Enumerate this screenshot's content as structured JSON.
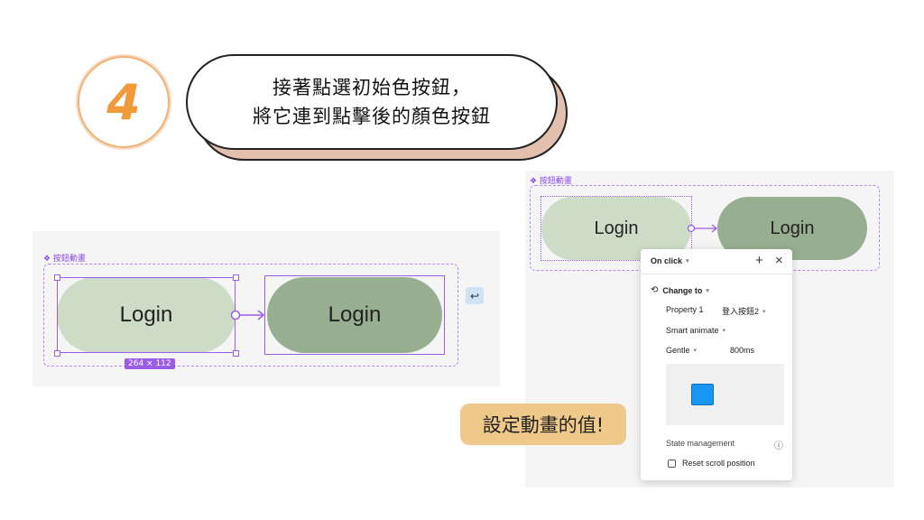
{
  "step": {
    "number": "4"
  },
  "instruction": {
    "line1": "接著點選初始色按鈕，",
    "line2": "將它連到點擊後的顏色按鈕"
  },
  "left_canvas": {
    "component_label": "❖ 按鈕動畫",
    "button_initial": "Login",
    "button_clicked": "Login",
    "size_badge": "264 × 112",
    "back_icon": "undo-arrow-icon"
  },
  "right_canvas": {
    "component_label": "❖ 按鈕動畫",
    "button_initial": "Login",
    "button_clicked": "Login"
  },
  "popover": {
    "trigger": "On click",
    "add_icon": "+",
    "close_icon": "×",
    "action": "Change to",
    "property_label": "Property 1",
    "property_value": "登入按鈕2",
    "animation": "Smart animate",
    "easing": "Gentle",
    "duration": "800ms",
    "state_management": "State management",
    "reset_scroll": "Reset scroll position"
  },
  "callout": {
    "text": "設定動畫的值!"
  },
  "colors": {
    "button_light": "#cddcc7",
    "button_dark": "#98ae90",
    "selection": "#9b5de5",
    "callout_bg": "#efc98a",
    "preview_square": "#1895f5"
  }
}
